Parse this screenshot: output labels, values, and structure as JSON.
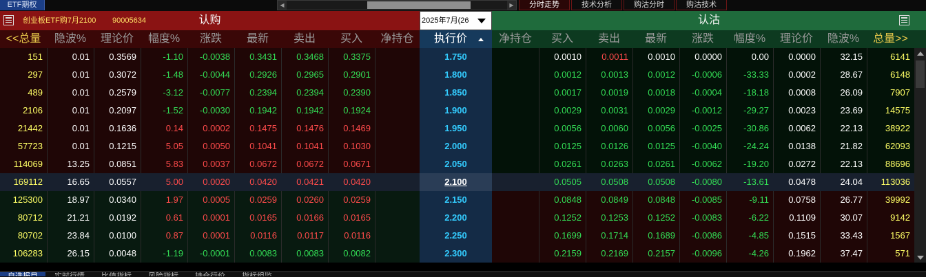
{
  "top_bar": {
    "etf_tab": "ETF期权",
    "view_tabs": [
      {
        "label": "分时走势",
        "active": true
      },
      {
        "label": "技术分析",
        "active": false
      },
      {
        "label": "购沽分时",
        "active": false
      },
      {
        "label": "购沽技术",
        "active": false
      }
    ]
  },
  "header": {
    "contract_name": "创业板ETF购7月2100",
    "contract_code": "90005634",
    "call_title": "认购",
    "put_title": "认沽",
    "month_select": "2025年7月(26"
  },
  "columns": {
    "call": [
      "<<总量",
      "隐波%",
      "理论价",
      "幅度%",
      "涨跌",
      "最新",
      "卖出",
      "买入",
      "净持仓"
    ],
    "strike": "执行价",
    "put": [
      "净持仓",
      "买入",
      "卖出",
      "最新",
      "涨跌",
      "幅度%",
      "理论价",
      "隐波%",
      "总量>>"
    ]
  },
  "rows": [
    {
      "strike": "1.750",
      "call": {
        "volume": "151",
        "iv": "0.01",
        "theo": "0.3569",
        "pct": "-1.10",
        "chg": "-0.0038",
        "last": "0.3431",
        "ask": "0.3468",
        "bid": "0.3375",
        "oi": ""
      },
      "put": {
        "oi": "",
        "bid": "0.0010",
        "ask": "0.0011",
        "last": "0.0010",
        "chg": "0.0000",
        "pct": "0.00",
        "theo": "0.0000",
        "iv": "32.15",
        "volume": "6141"
      }
    },
    {
      "strike": "1.800",
      "call": {
        "volume": "297",
        "iv": "0.01",
        "theo": "0.3072",
        "pct": "-1.48",
        "chg": "-0.0044",
        "last": "0.2926",
        "ask": "0.2965",
        "bid": "0.2901",
        "oi": ""
      },
      "put": {
        "oi": "",
        "bid": "0.0012",
        "ask": "0.0013",
        "last": "0.0012",
        "chg": "-0.0006",
        "pct": "-33.33",
        "theo": "0.0002",
        "iv": "28.67",
        "volume": "6148"
      }
    },
    {
      "strike": "1.850",
      "call": {
        "volume": "489",
        "iv": "0.01",
        "theo": "0.2579",
        "pct": "-3.12",
        "chg": "-0.0077",
        "last": "0.2394",
        "ask": "0.2394",
        "bid": "0.2390",
        "oi": ""
      },
      "put": {
        "oi": "",
        "bid": "0.0017",
        "ask": "0.0019",
        "last": "0.0018",
        "chg": "-0.0004",
        "pct": "-18.18",
        "theo": "0.0008",
        "iv": "26.09",
        "volume": "7907"
      }
    },
    {
      "strike": "1.900",
      "call": {
        "volume": "2106",
        "iv": "0.01",
        "theo": "0.2097",
        "pct": "-1.52",
        "chg": "-0.0030",
        "last": "0.1942",
        "ask": "0.1942",
        "bid": "0.1924",
        "oi": ""
      },
      "put": {
        "oi": "",
        "bid": "0.0029",
        "ask": "0.0031",
        "last": "0.0029",
        "chg": "-0.0012",
        "pct": "-29.27",
        "theo": "0.0023",
        "iv": "23.69",
        "volume": "14575"
      }
    },
    {
      "strike": "1.950",
      "call": {
        "volume": "21442",
        "iv": "0.01",
        "theo": "0.1636",
        "pct": "0.14",
        "chg": "0.0002",
        "last": "0.1475",
        "ask": "0.1476",
        "bid": "0.1469",
        "oi": ""
      },
      "put": {
        "oi": "",
        "bid": "0.0056",
        "ask": "0.0060",
        "last": "0.0056",
        "chg": "-0.0025",
        "pct": "-30.86",
        "theo": "0.0062",
        "iv": "22.13",
        "volume": "38922"
      }
    },
    {
      "strike": "2.000",
      "call": {
        "volume": "57723",
        "iv": "0.01",
        "theo": "0.1215",
        "pct": "5.05",
        "chg": "0.0050",
        "last": "0.1041",
        "ask": "0.1041",
        "bid": "0.1030",
        "oi": ""
      },
      "put": {
        "oi": "",
        "bid": "0.0125",
        "ask": "0.0126",
        "last": "0.0125",
        "chg": "-0.0040",
        "pct": "-24.24",
        "theo": "0.0138",
        "iv": "21.82",
        "volume": "62093"
      }
    },
    {
      "strike": "2.050",
      "call": {
        "volume": "114069",
        "iv": "13.25",
        "theo": "0.0851",
        "pct": "5.83",
        "chg": "0.0037",
        "last": "0.0672",
        "ask": "0.0672",
        "bid": "0.0671",
        "oi": ""
      },
      "put": {
        "oi": "",
        "bid": "0.0261",
        "ask": "0.0263",
        "last": "0.0261",
        "chg": "-0.0062",
        "pct": "-19.20",
        "theo": "0.0272",
        "iv": "22.13",
        "volume": "88696"
      }
    },
    {
      "strike": "2.100",
      "call": {
        "volume": "169112",
        "iv": "16.65",
        "theo": "0.0557",
        "pct": "5.00",
        "chg": "0.0020",
        "last": "0.0420",
        "ask": "0.0421",
        "bid": "0.0420",
        "oi": ""
      },
      "put": {
        "oi": "",
        "bid": "0.0505",
        "ask": "0.0508",
        "last": "0.0508",
        "chg": "-0.0080",
        "pct": "-13.61",
        "theo": "0.0478",
        "iv": "24.04",
        "volume": "113036"
      }
    },
    {
      "strike": "2.150",
      "call": {
        "volume": "125300",
        "iv": "18.97",
        "theo": "0.0340",
        "pct": "1.97",
        "chg": "0.0005",
        "last": "0.0259",
        "ask": "0.0260",
        "bid": "0.0259",
        "oi": ""
      },
      "put": {
        "oi": "",
        "bid": "0.0848",
        "ask": "0.0849",
        "last": "0.0848",
        "chg": "-0.0085",
        "pct": "-9.11",
        "theo": "0.0758",
        "iv": "26.77",
        "volume": "39992"
      }
    },
    {
      "strike": "2.200",
      "call": {
        "volume": "80712",
        "iv": "21.21",
        "theo": "0.0192",
        "pct": "0.61",
        "chg": "0.0001",
        "last": "0.0165",
        "ask": "0.0166",
        "bid": "0.0165",
        "oi": ""
      },
      "put": {
        "oi": "",
        "bid": "0.1252",
        "ask": "0.1253",
        "last": "0.1252",
        "chg": "-0.0083",
        "pct": "-6.22",
        "theo": "0.1109",
        "iv": "30.07",
        "volume": "9142"
      }
    },
    {
      "strike": "2.250",
      "call": {
        "volume": "80702",
        "iv": "23.84",
        "theo": "0.0100",
        "pct": "0.87",
        "chg": "0.0001",
        "last": "0.0116",
        "ask": "0.0117",
        "bid": "0.0116",
        "oi": ""
      },
      "put": {
        "oi": "",
        "bid": "0.1699",
        "ask": "0.1714",
        "last": "0.1689",
        "chg": "-0.0086",
        "pct": "-4.85",
        "theo": "0.1515",
        "iv": "33.43",
        "volume": "1567"
      }
    },
    {
      "strike": "2.300",
      "call": {
        "volume": "106283",
        "iv": "26.15",
        "theo": "0.0048",
        "pct": "-1.19",
        "chg": "-0.0001",
        "last": "0.0083",
        "ask": "0.0083",
        "bid": "0.0082",
        "oi": ""
      },
      "put": {
        "oi": "",
        "bid": "0.2159",
        "ask": "0.2169",
        "last": "0.2157",
        "chg": "-0.0096",
        "pct": "-4.26",
        "theo": "0.1962",
        "iv": "37.47",
        "volume": "571"
      }
    }
  ],
  "bottom_tabs": [
    "自选报目",
    "实时行情",
    "比值指标",
    "风险指标",
    "持仓行价",
    "指标组监"
  ],
  "colors": {
    "up": "#ff4b4b",
    "down": "#33dd55",
    "neutral": "#ffffff",
    "strike": "#33ccff",
    "volume": "#ffff66",
    "call_header": "#8a1313",
    "put_header": "#1f6b3c"
  }
}
